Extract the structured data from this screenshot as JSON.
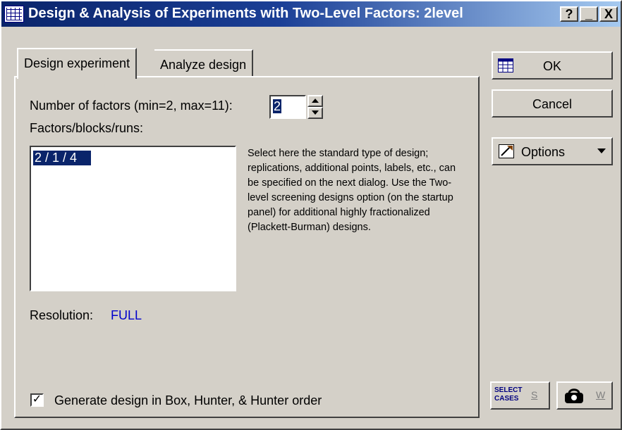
{
  "window": {
    "title": "Design & Analysis of Experiments with Two-Level Factors: 2level",
    "help_label": "?",
    "minimize_label": "_",
    "close_label": "X"
  },
  "tabs": [
    {
      "label": "Design experiment",
      "active": true
    },
    {
      "label": "Analyze design",
      "active": false
    }
  ],
  "form": {
    "factors_label": "Number of factors (min=2, max=11):",
    "factors_value": "2",
    "list_label": "Factors/blocks/runs:",
    "list_items": [
      "2 / 1 / 4"
    ],
    "selected_item": "2 / 1 / 4",
    "description": "Select here the standard type of design; replications, additional points, labels, etc., can be specified on the next dialog. Use the Two-level screening designs option (on the startup panel) for additional highly fractionalized (Plackett-Burman) designs.",
    "resolution_label": "Resolution:",
    "resolution_value": "FULL",
    "resolution_color": "#0000cc",
    "checkbox_label": "Generate design in Box, Hunter, & Hunter order",
    "checkbox_checked": true
  },
  "buttons": {
    "ok": "OK",
    "cancel": "Cancel",
    "options": "Options",
    "select_cases_line1": "SELECT",
    "select_cases_line2": "CASES",
    "select_cases_letter": "S",
    "weight_letter": "W"
  },
  "colors": {
    "title_start": "#0a246a",
    "title_end": "#a6caf0",
    "face": "#d4d0c8",
    "selection": "#0a246a"
  }
}
